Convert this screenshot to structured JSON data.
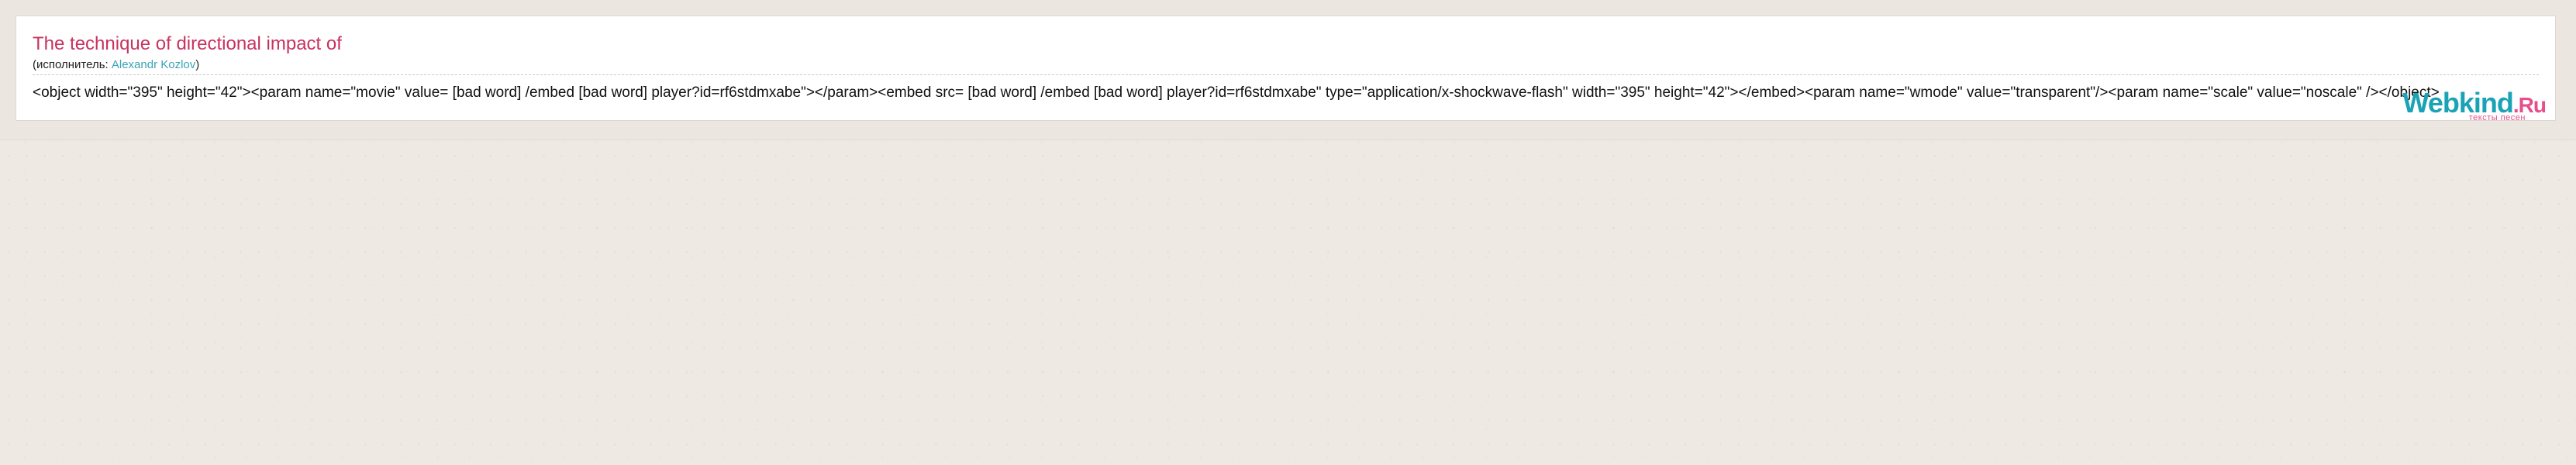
{
  "song": {
    "title": "The technique of directional impact of",
    "performer_prefix": "(исполнитель: ",
    "performer_name": "Alexandr Kozlov",
    "performer_suffix": ")",
    "lyrics": "<object width=\"395\" height=\"42\"><param name=\"movie\" value= [bad word] /embed [bad word] player?id=rf6stdmxabe\"></param><embed src= [bad word] /embed [bad word] player?id=rf6stdmxabe\" type=\"application/x-shockwave-flash\" width=\"395\" height=\"42\"></embed><param name=\"wmode\" value=\"transparent\"/><param name=\"scale\" value=\"noscale\" /></object>"
  },
  "logo": {
    "main": "Webkind",
    "tld": ".Ru",
    "tagline": "тексты песен"
  },
  "colors": {
    "title": "#c8325f",
    "link": "#3aa3b6",
    "logo_primary": "#1aa3b5",
    "logo_accent": "#e64f8c",
    "background": "#efe9e4"
  }
}
